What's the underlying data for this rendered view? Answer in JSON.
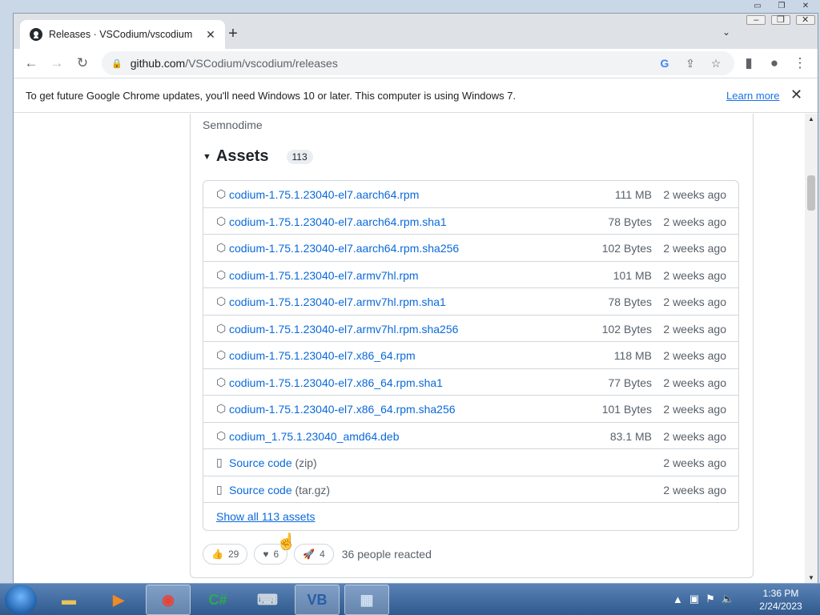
{
  "browser": {
    "tab_title": "Releases · VSCodium/vscodium",
    "url_host": "github.com",
    "url_path": "/VSCodium/vscodium/releases",
    "infobar_message": "To get future Google Chrome updates, you'll need Windows 10 or later. This computer is using Windows 7.",
    "infobar_link": "Learn more"
  },
  "release": {
    "author": "Semnodime",
    "assets_label": "Assets",
    "assets_count": "113",
    "assets": [
      {
        "name": "codium-1.75.1.23040-el7.aarch64.rpm",
        "size": "111 MB",
        "date": "2 weeks ago"
      },
      {
        "name": "codium-1.75.1.23040-el7.aarch64.rpm.sha1",
        "size": "78 Bytes",
        "date": "2 weeks ago"
      },
      {
        "name": "codium-1.75.1.23040-el7.aarch64.rpm.sha256",
        "size": "102 Bytes",
        "date": "2 weeks ago"
      },
      {
        "name": "codium-1.75.1.23040-el7.armv7hl.rpm",
        "size": "101 MB",
        "date": "2 weeks ago"
      },
      {
        "name": "codium-1.75.1.23040-el7.armv7hl.rpm.sha1",
        "size": "78 Bytes",
        "date": "2 weeks ago"
      },
      {
        "name": "codium-1.75.1.23040-el7.armv7hl.rpm.sha256",
        "size": "102 Bytes",
        "date": "2 weeks ago"
      },
      {
        "name": "codium-1.75.1.23040-el7.x86_64.rpm",
        "size": "118 MB",
        "date": "2 weeks ago"
      },
      {
        "name": "codium-1.75.1.23040-el7.x86_64.rpm.sha1",
        "size": "77 Bytes",
        "date": "2 weeks ago"
      },
      {
        "name": "codium-1.75.1.23040-el7.x86_64.rpm.sha256",
        "size": "101 Bytes",
        "date": "2 weeks ago"
      },
      {
        "name": "codium_1.75.1.23040_amd64.deb",
        "size": "83.1 MB",
        "date": "2 weeks ago"
      }
    ],
    "source": [
      {
        "name": "Source code",
        "paren": "(zip)",
        "date": "2 weeks ago"
      },
      {
        "name": "Source code",
        "paren": "(tar.gz)",
        "date": "2 weeks ago"
      }
    ],
    "show_all": "Show all 113 assets",
    "reactions": {
      "thumbs": "29",
      "heart": "6",
      "rocket": "4",
      "summary": "36 people reacted"
    }
  },
  "taskbar": {
    "time": "1:36 PM",
    "date": "2/24/2023"
  }
}
